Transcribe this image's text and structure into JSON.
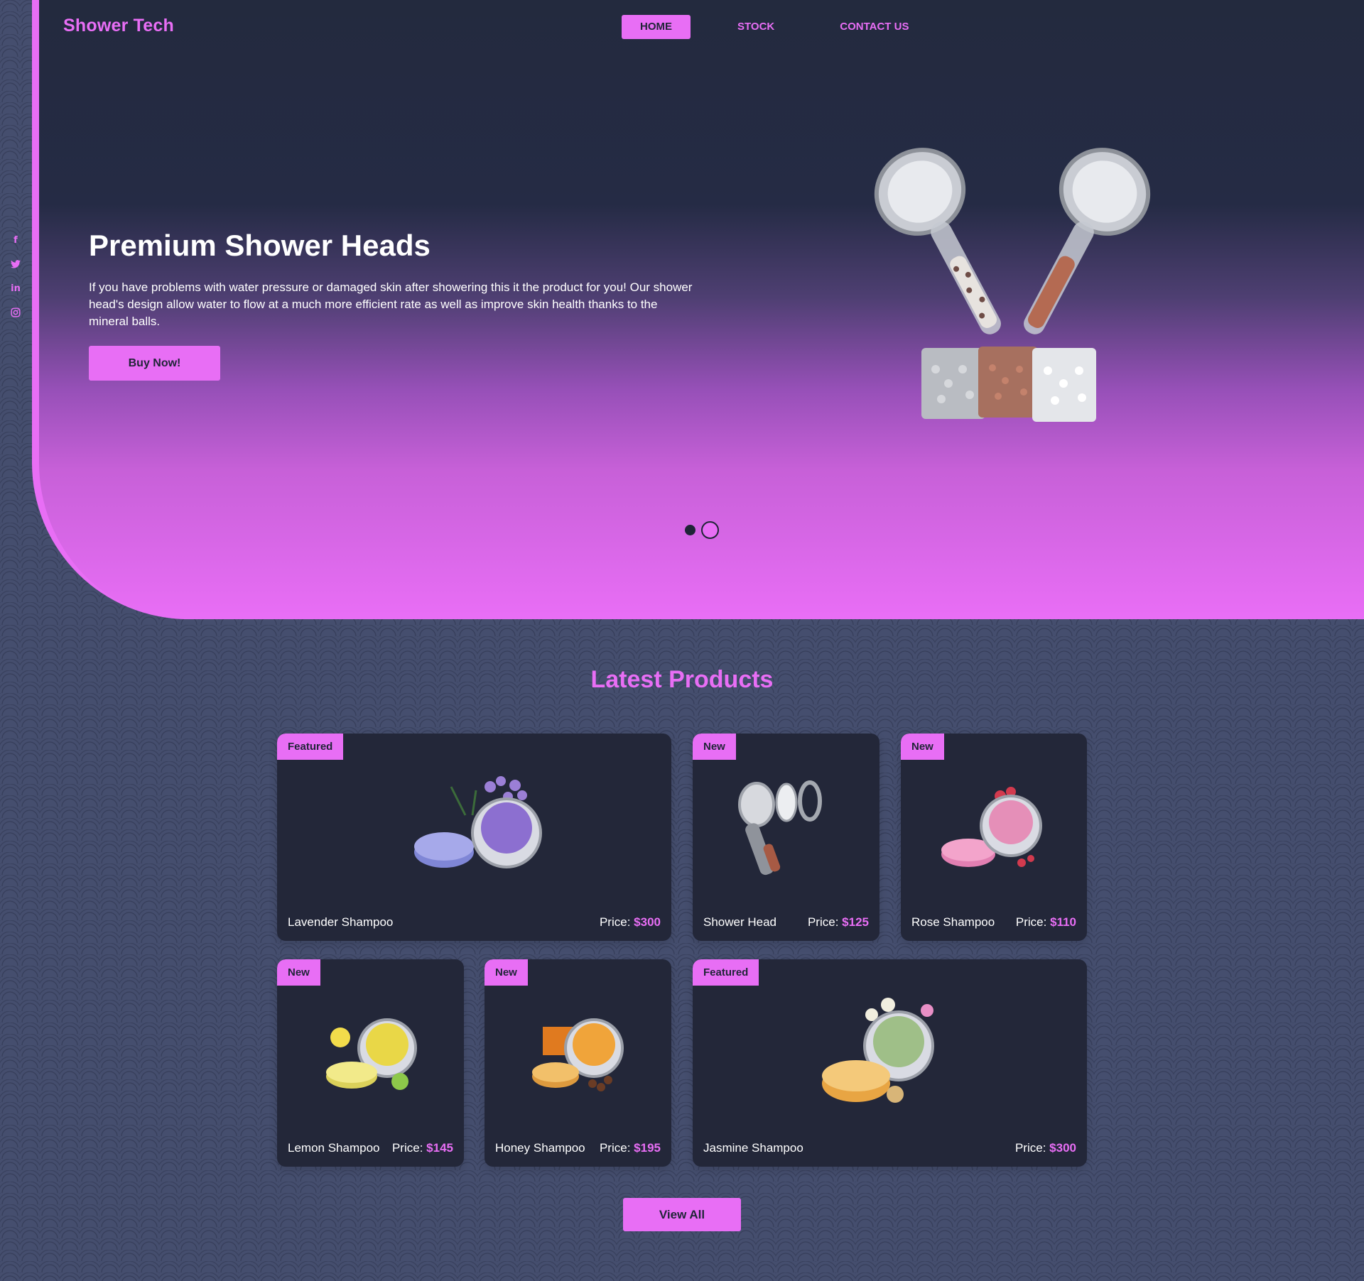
{
  "brand": "Shower Tech",
  "nav": {
    "home": "HOME",
    "stock": "STOCK",
    "contact": "CONTACT US"
  },
  "social": [
    "facebook-icon",
    "twitter-icon",
    "linkedin-icon",
    "instagram-icon"
  ],
  "hero": {
    "title": "Premium Shower Heads",
    "text": "If you have problems with water pressure or damaged skin after showering this it the product for you! Our shower head's design allow water to flow at a much more efficient rate as well as improve skin health thanks to the mineral balls.",
    "button": "Buy Now!",
    "slides_total": 2,
    "slide_active": 2
  },
  "products_title": "Latest Products",
  "products": [
    {
      "badge": "Featured",
      "name": "Lavender Shampoo",
      "price_label": "Price:",
      "price": "$300"
    },
    {
      "badge": "New",
      "name": "Shower Head",
      "price_label": "Price:",
      "price": "$125"
    },
    {
      "badge": "New",
      "name": "Rose Shampoo",
      "price_label": "Price:",
      "price": "$110"
    },
    {
      "badge": "New",
      "name": "Lemon Shampoo",
      "price_label": "Price:",
      "price": "$145"
    },
    {
      "badge": "New",
      "name": "Honey Shampoo",
      "price_label": "Price:",
      "price": "$195"
    },
    {
      "badge": "Featured",
      "name": "Jasmine Shampoo",
      "price_label": "Price:",
      "price": "$300"
    }
  ],
  "view_all": "View All",
  "colors": {
    "accent": "#e86ef5",
    "dark": "#232739",
    "background": "#454e6e"
  }
}
